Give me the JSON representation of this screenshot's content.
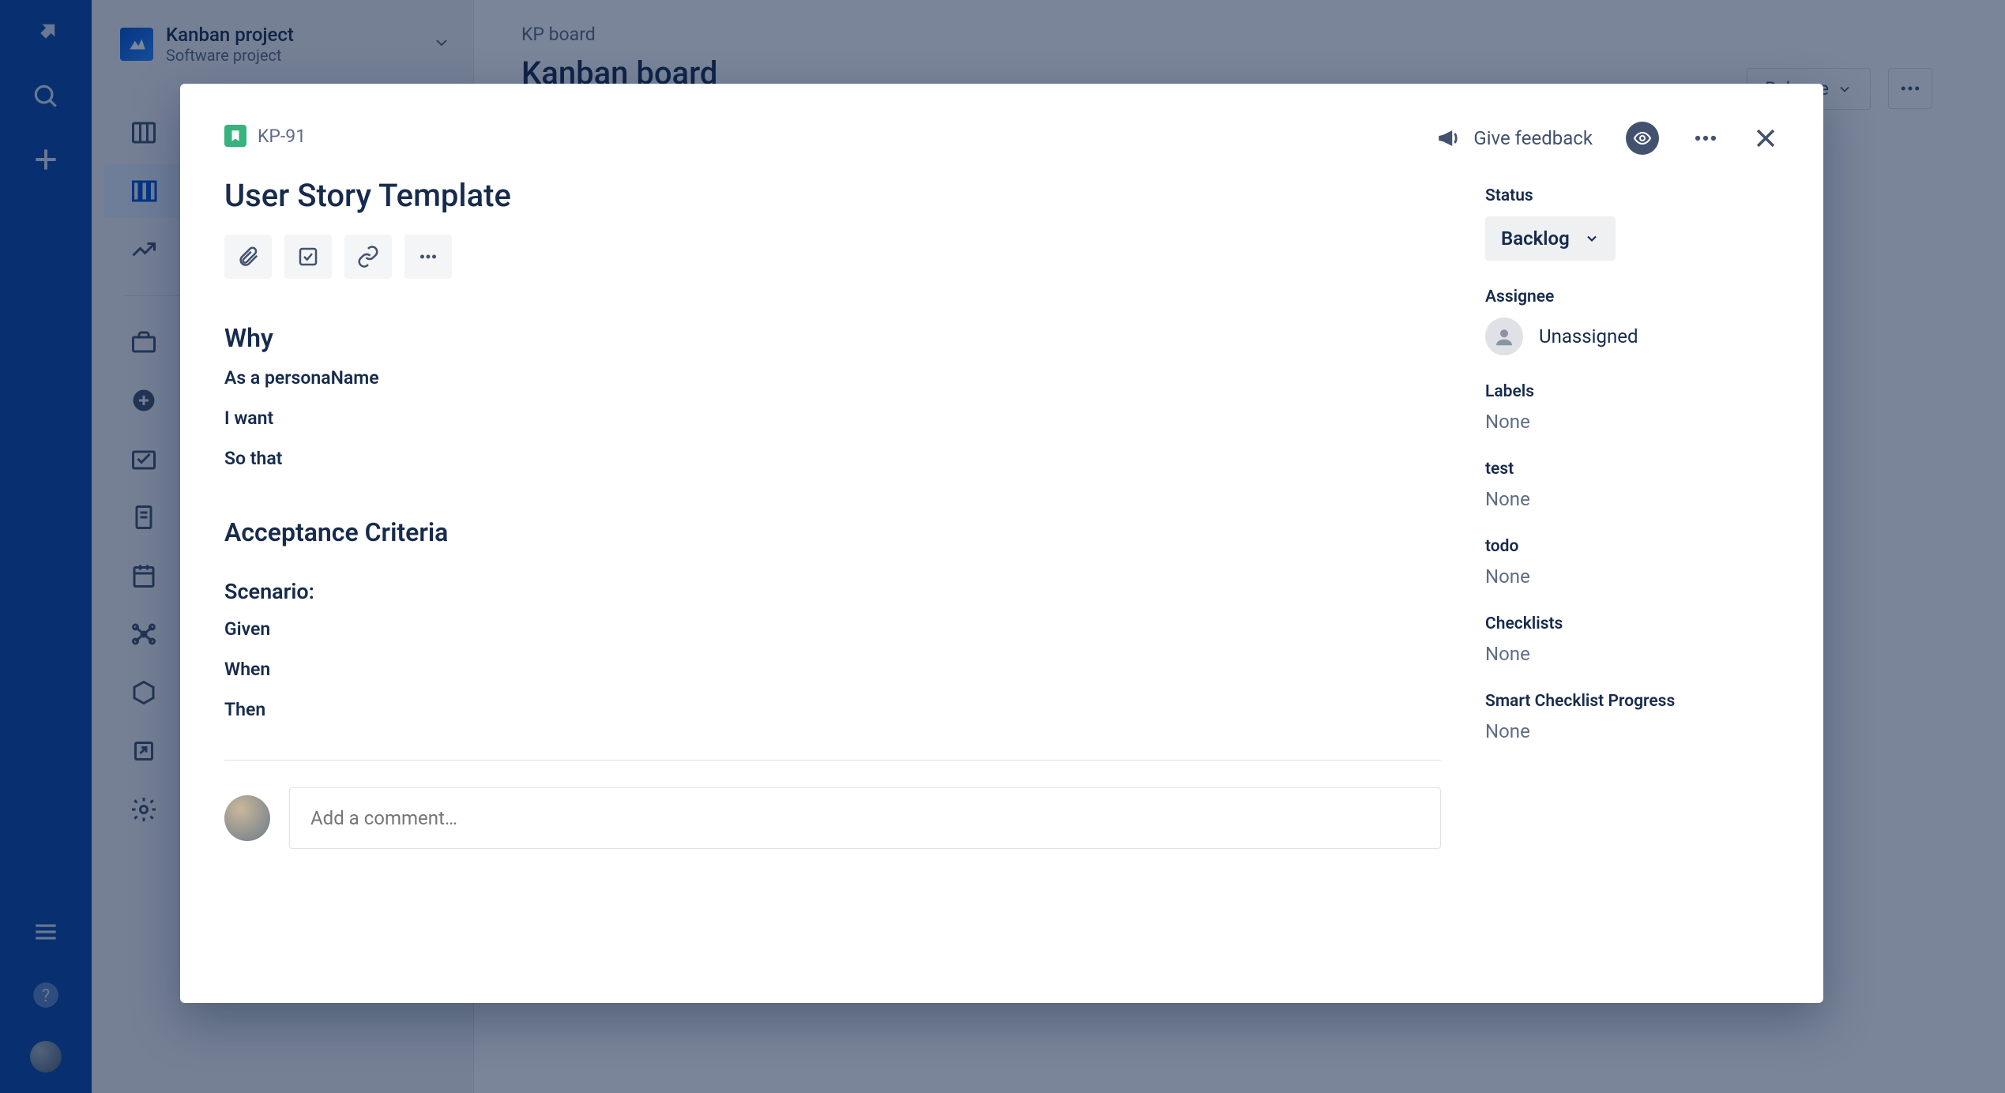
{
  "project": {
    "name": "Kanban project",
    "type": "Software project"
  },
  "breadcrumb": "KP board",
  "board_title": "Kanban board",
  "release_label": "Release",
  "issue": {
    "key": "KP-91",
    "title": "User Story Template",
    "feedback_label": "Give feedback",
    "sections": {
      "why_heading": "Why",
      "why_lines": [
        "As a personaName",
        "I want",
        "So that"
      ],
      "ac_heading": "Acceptance Criteria",
      "scenario_heading": "Scenario:",
      "ac_lines": [
        "Given",
        "When",
        "Then"
      ]
    },
    "comment_placeholder": "Add a comment…"
  },
  "side": {
    "status_label": "Status",
    "status_value": "Backlog",
    "assignee_label": "Assignee",
    "assignee_value": "Unassigned",
    "fields": [
      {
        "label": "Labels",
        "value": "None"
      },
      {
        "label": "test",
        "value": "None"
      },
      {
        "label": "todo",
        "value": "None"
      },
      {
        "label": "Checklists",
        "value": "None"
      },
      {
        "label": "Smart Checklist Progress",
        "value": "None"
      }
    ]
  }
}
